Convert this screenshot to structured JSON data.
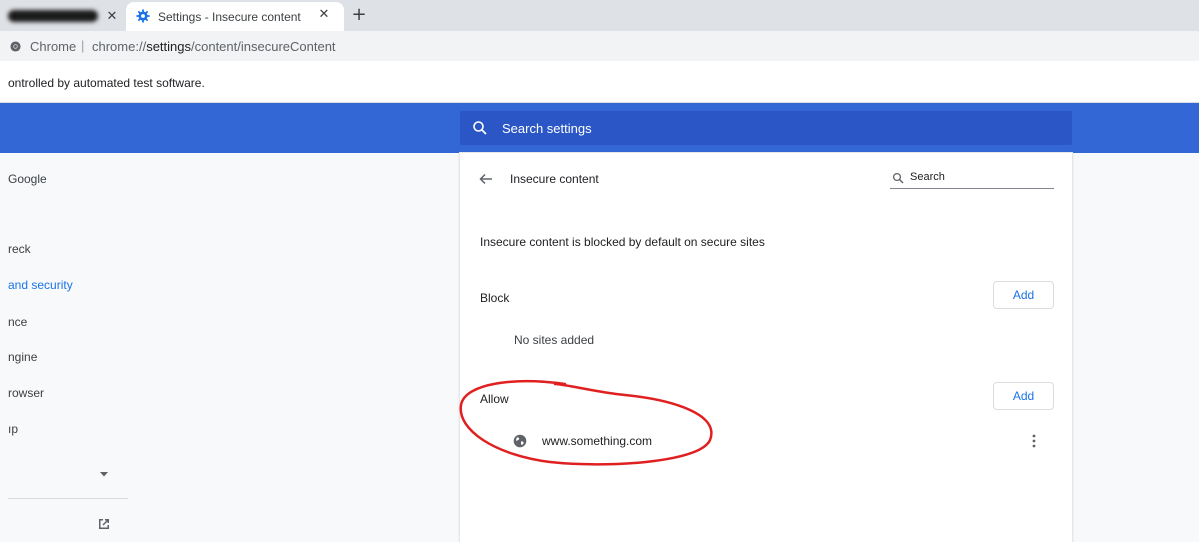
{
  "tabs": [
    {
      "title": "",
      "redacted": true
    },
    {
      "title": "Settings - Insecure content",
      "active": true
    }
  ],
  "omnibox": {
    "site_label": "Chrome",
    "separator": "|",
    "url_prefix": "chrome://",
    "url_host": "settings",
    "url_path": "/content/insecureContent"
  },
  "infobar": {
    "text": "ontrolled by automated test software."
  },
  "header": {
    "search_placeholder": "Search settings"
  },
  "sidebar": {
    "items": [
      {
        "label": "Google"
      },
      {
        "label": "reck"
      },
      {
        "label": "and security",
        "active": true
      },
      {
        "label": "nce"
      },
      {
        "label": "ngine"
      },
      {
        "label": "rowser"
      },
      {
        "label": "ıp"
      }
    ]
  },
  "page": {
    "title": "Insecure content",
    "search_placeholder": "Search",
    "description": "Insecure content is blocked by default on secure sites",
    "block": {
      "label": "Block",
      "add_label": "Add",
      "empty_text": "No sites added"
    },
    "allow": {
      "label": "Allow",
      "add_label": "Add",
      "sites": [
        {
          "url": "www.something.com"
        }
      ]
    }
  },
  "colors": {
    "header_blue": "#3367d6",
    "search_blue": "#2a56c6",
    "link_blue": "#1a73e8",
    "annotation_red": "#e02020"
  }
}
